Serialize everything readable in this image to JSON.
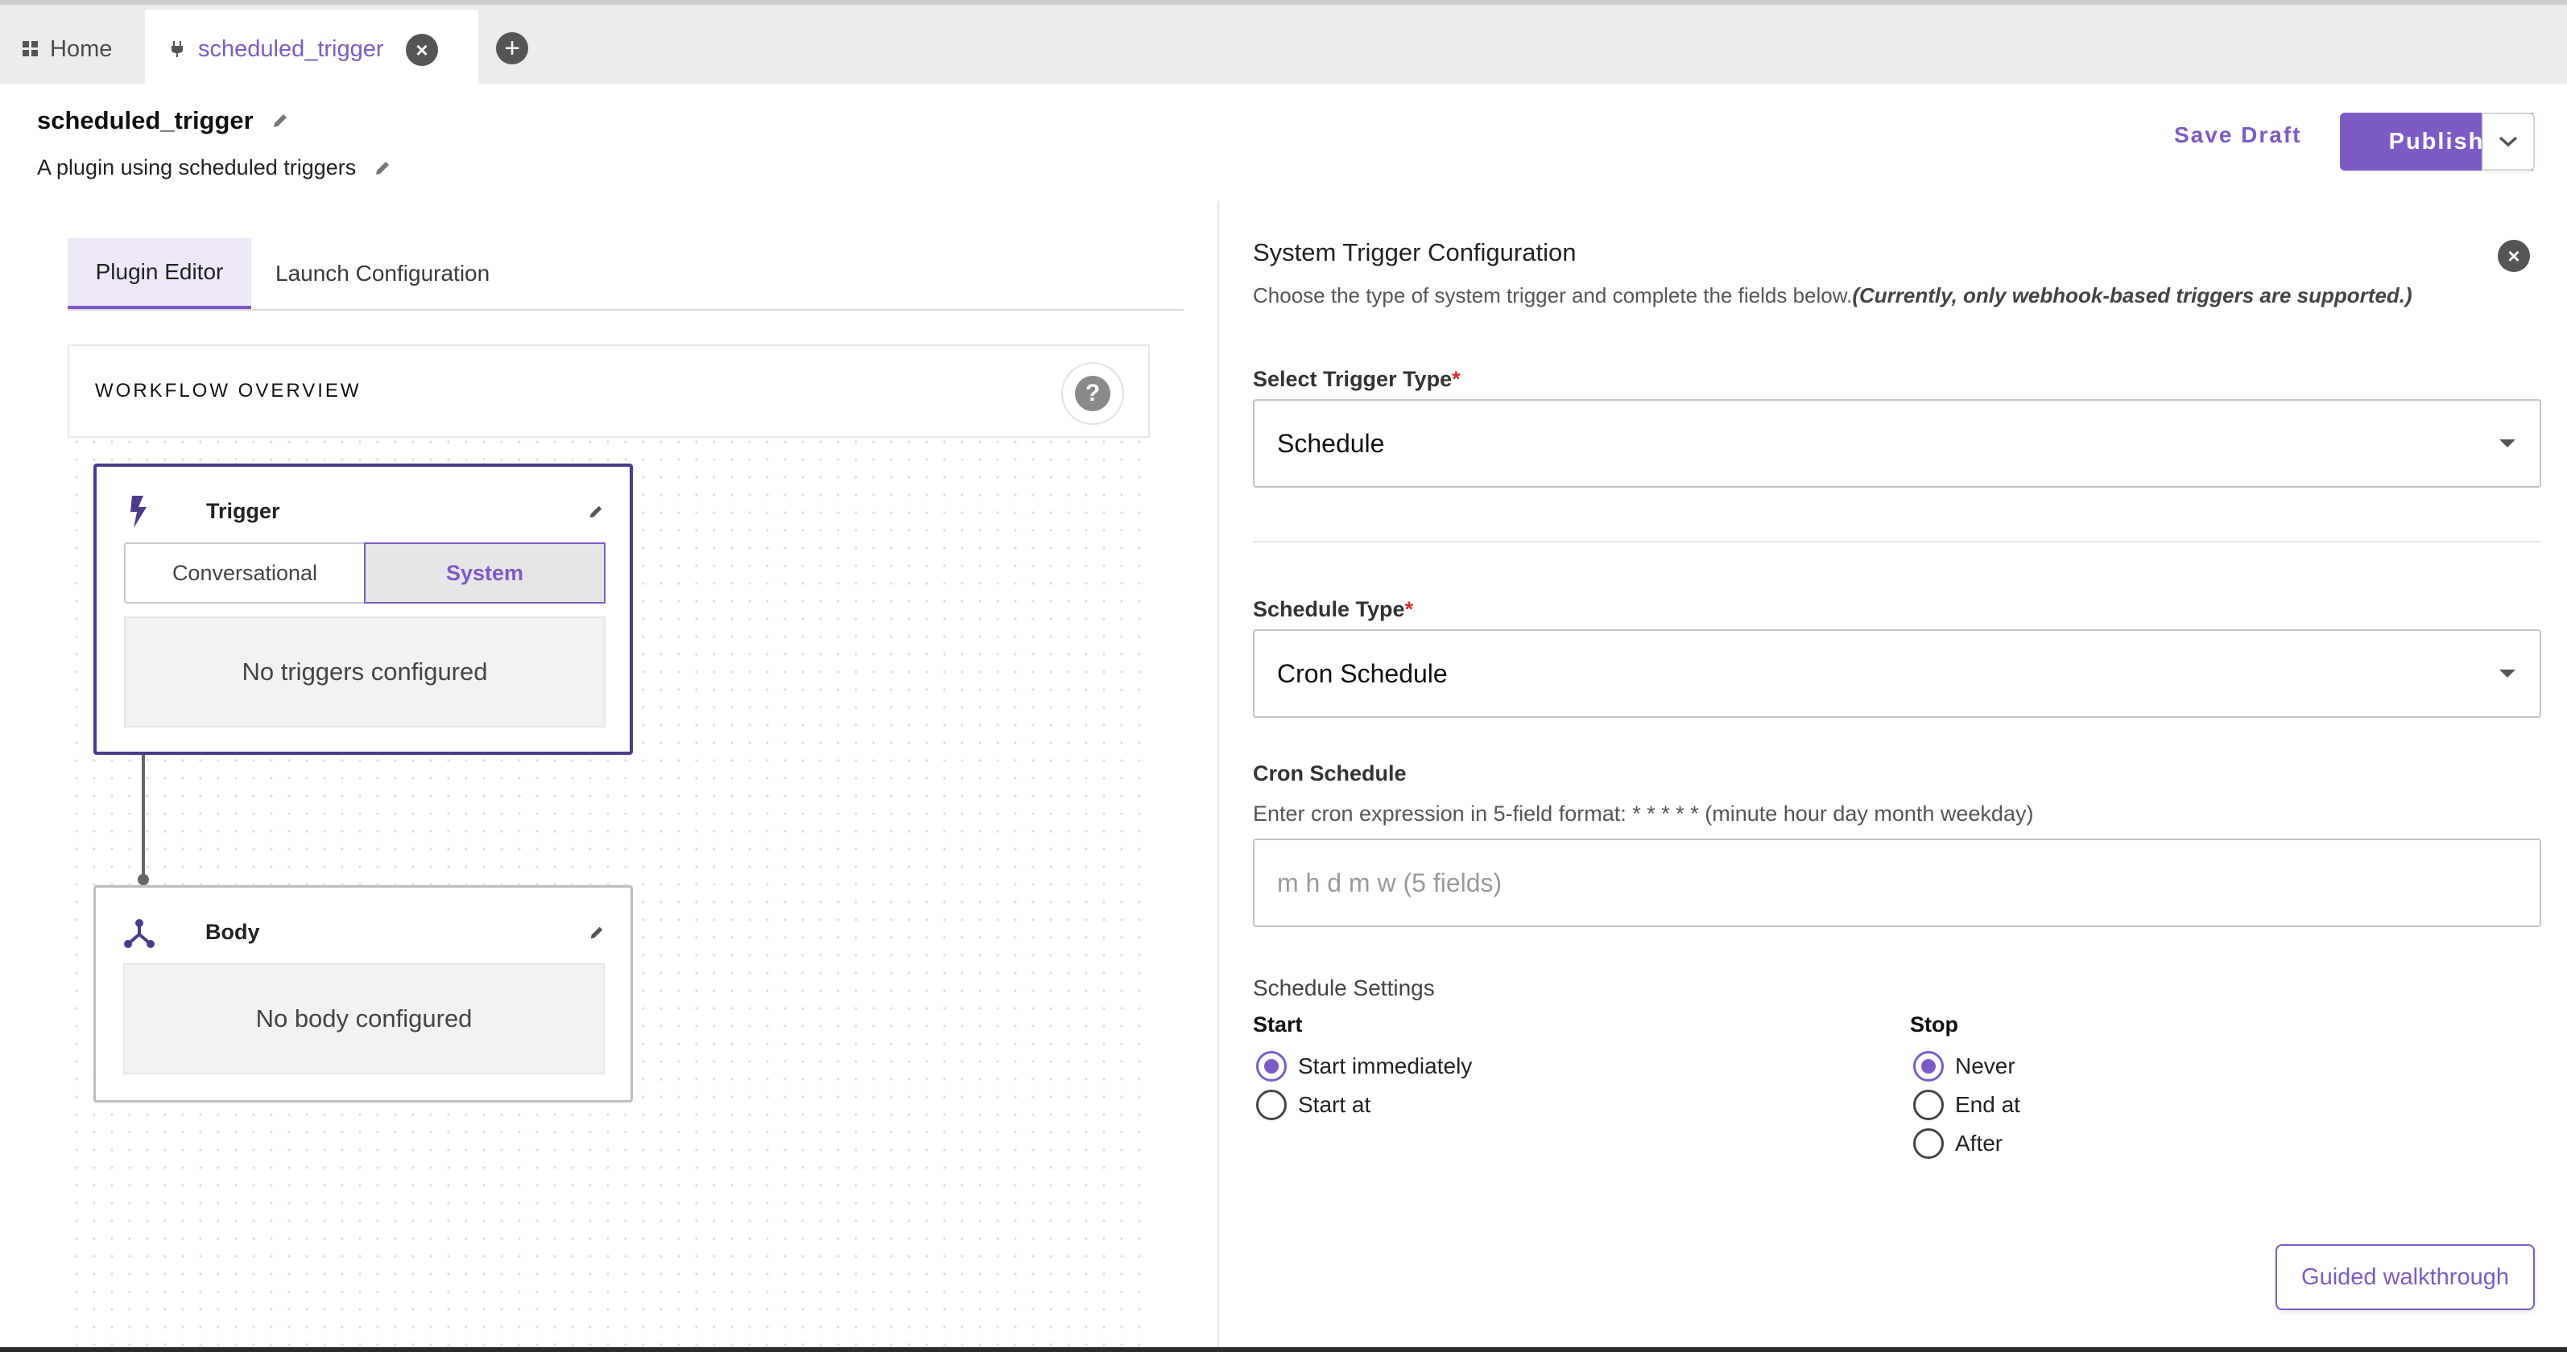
{
  "tabs": {
    "home": "Home",
    "active": "scheduled_trigger"
  },
  "header": {
    "title": "scheduled_trigger",
    "description": "A plugin using scheduled triggers",
    "save_draft": "Save Draft",
    "publish": "Publish"
  },
  "editor_tabs": {
    "plugin_editor": "Plugin Editor",
    "launch_configuration": "Launch Configuration"
  },
  "workflow": {
    "overview_title": "WORKFLOW OVERVIEW",
    "help_glyph": "?",
    "trigger": {
      "name": "Trigger",
      "segments": [
        "Conversational",
        "System"
      ],
      "selected_segment": "System",
      "empty": "No triggers configured"
    },
    "body": {
      "name": "Body",
      "empty": "No body configured"
    }
  },
  "config": {
    "title": "System Trigger Configuration",
    "subtitle": "Choose the type of system trigger and complete the fields below.",
    "subtitle_note": "(Currently, only webhook-based triggers are supported.)",
    "trigger_type_label": "Select Trigger Type",
    "trigger_type_value": "Schedule",
    "required_mark": "*",
    "schedule_type_label": "Schedule Type",
    "schedule_type_value": "Cron Schedule",
    "cron_label": "Cron Schedule",
    "cron_helper": "Enter cron expression in 5-field format: * * * * * (minute hour day month weekday)",
    "cron_placeholder": "m h d m w (5 fields)",
    "cron_value": "",
    "settings_label": "Schedule Settings",
    "start_label": "Start",
    "start_options": [
      "Start immediately",
      "Start at"
    ],
    "start_selected": "Start immediately",
    "stop_label": "Stop",
    "stop_options": [
      "Never",
      "End at",
      "After"
    ],
    "stop_selected": "Never"
  },
  "guided_walkthrough": "Guided walkthrough",
  "colors": {
    "accent": "#7c5cc4",
    "trigger_border": "#4d3a8a",
    "required": "#d32f2f"
  },
  "icons": {
    "home": "grid-icon",
    "tab_plugin": "plugin-icon",
    "tab_close": "close-icon",
    "tab_add": "add-icon",
    "edit": "pencil-icon",
    "dropdown": "chevron-down-icon",
    "help": "help-icon",
    "trigger": "lightning-icon",
    "body": "fork-icon"
  }
}
